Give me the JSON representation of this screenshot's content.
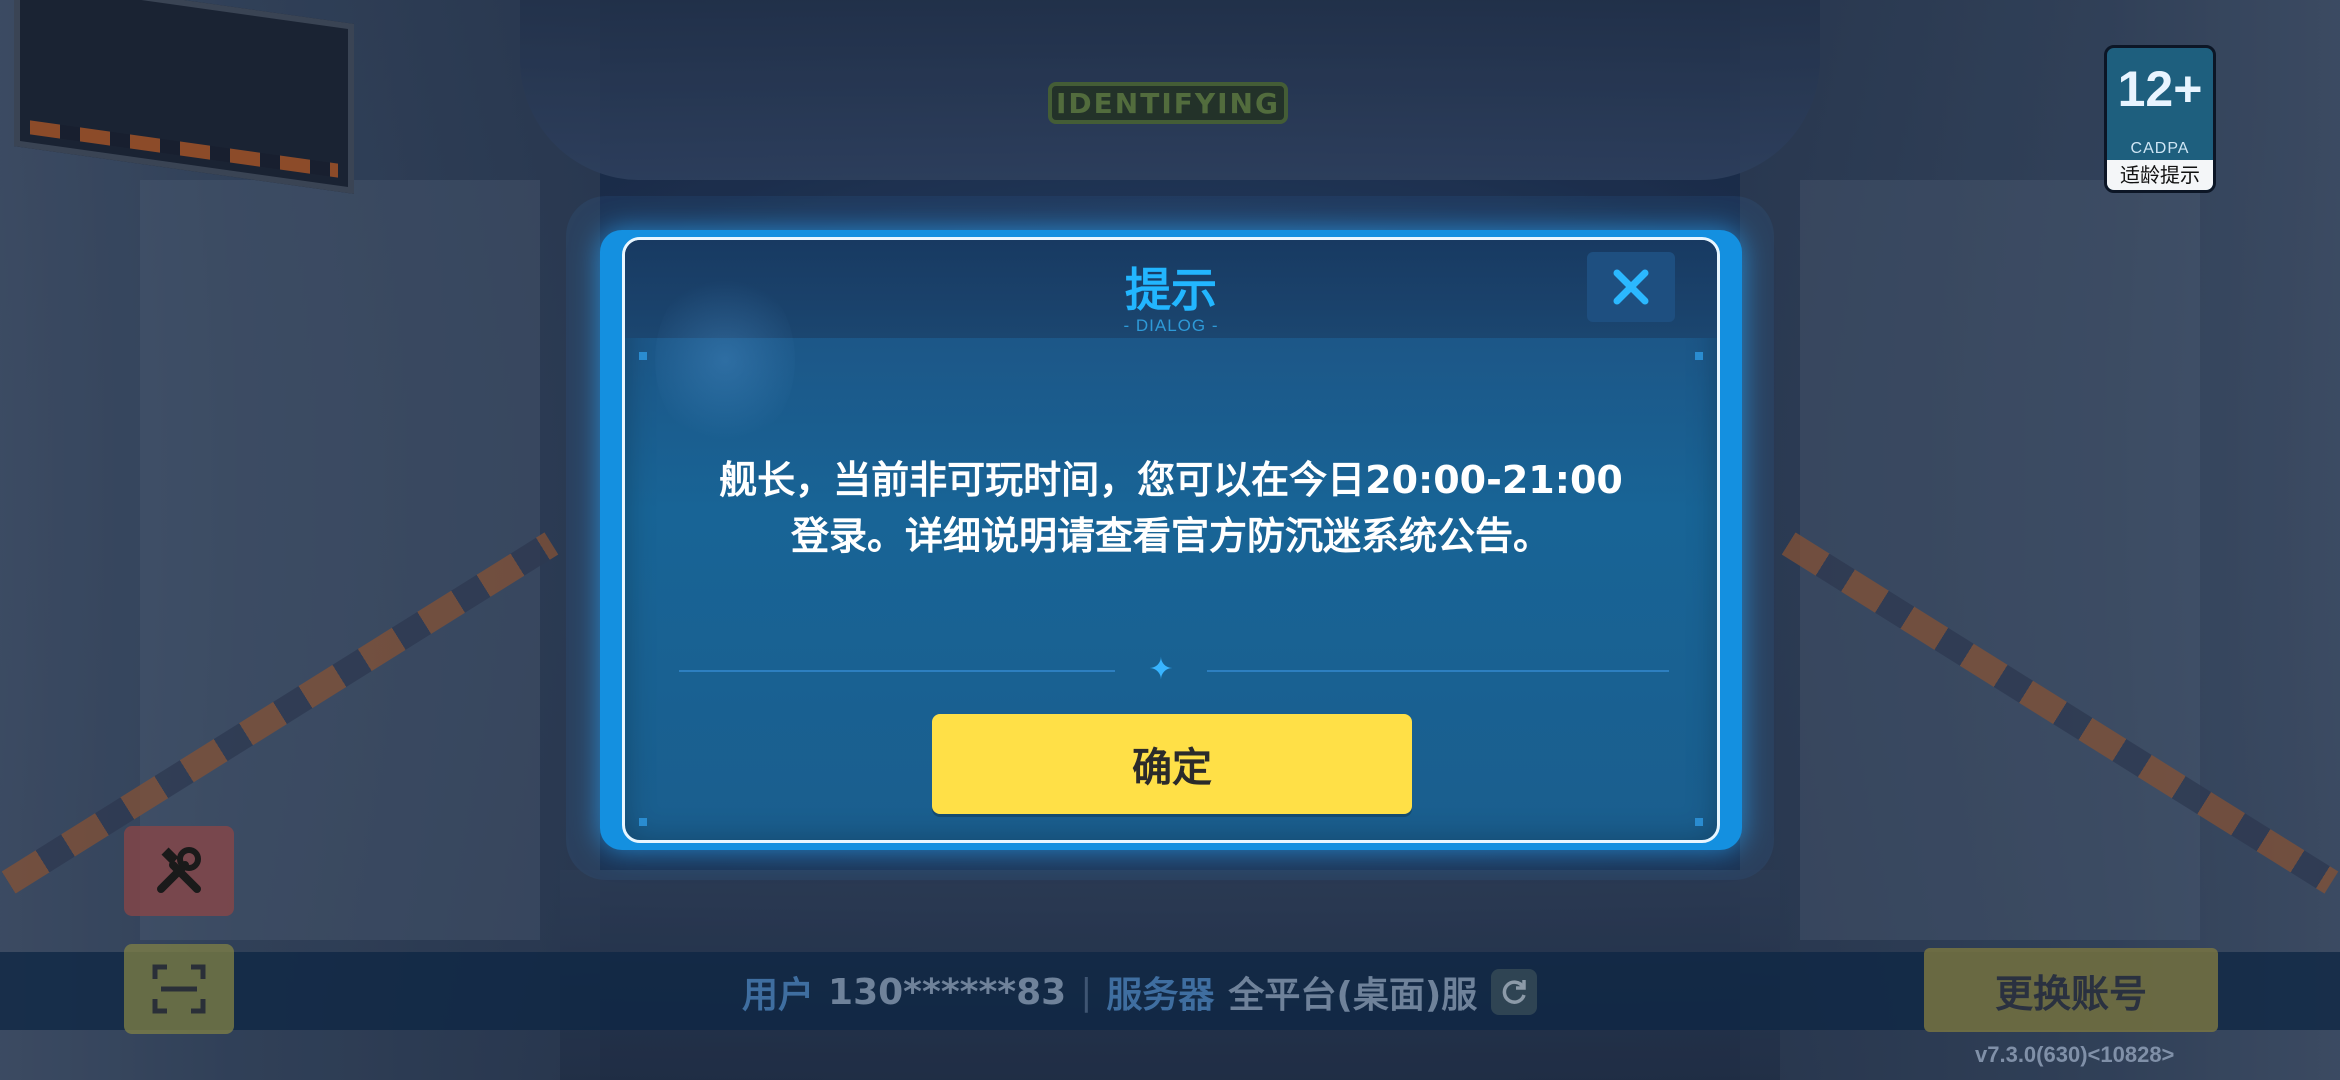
{
  "background": {
    "sign_text": "IDENTIFYING"
  },
  "age_rating": {
    "number": "12+",
    "org": "CADPA",
    "label": "适龄提示"
  },
  "dialog": {
    "title": "提示",
    "subtitle": "- DIALOG -",
    "message_line1": "舰长，当前非可玩时间，您可以在今日20:00-21:00",
    "message_line2": "登录。详细说明请查看官方防沉迷系统公告。",
    "confirm_label": "确定",
    "close_icon": "close-icon"
  },
  "bottom_bar": {
    "user_label": "用户",
    "user_value": "130******83",
    "separator": "|",
    "server_label": "服务器",
    "server_value": "全平台(桌面)服",
    "switch_account_label": "更换账号",
    "version": "v7.3.0(630)<10828>"
  },
  "colors": {
    "dialog_title": "#22b6ff",
    "confirm_button": "#ffe047",
    "dialog_border": "#1490e0"
  }
}
